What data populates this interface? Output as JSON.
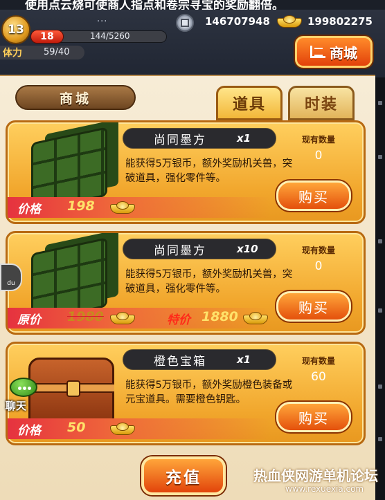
{
  "hud": {
    "ticker": "使用点云烧可使商人指点和卷宗寻宝的奖励翻倍。",
    "level_badge": "13",
    "player_name": "...",
    "level": "18",
    "exp": "144/5260",
    "exp_fraction": 0.027,
    "stamina_label": "体力",
    "stamina": "59/40",
    "silver": "146707948",
    "gold": "199802275",
    "shop_button": "商城",
    "icons": [
      "silver-coin-icon",
      "gold-ingot-icon",
      "cart-icon"
    ]
  },
  "panel": {
    "title": "商城",
    "tabs": [
      {
        "label": "道具",
        "active": true
      },
      {
        "label": "时装",
        "active": false
      }
    ]
  },
  "items": [
    {
      "name": "尚同墨方",
      "qty": "x1",
      "desc": "能获得5万银币，额外奖励机关兽，突破道具，强化零件等。",
      "stock_label": "现有数量",
      "stock": "0",
      "buy": "购买",
      "price_label": "价格",
      "price": "198"
    },
    {
      "name": "尚同墨方",
      "qty": "x10",
      "desc": "能获得5万银币，额外奖励机关兽，突破道具，强化零件等。",
      "stock_label": "现有数量",
      "stock": "0",
      "buy": "购买",
      "price_label": "原价",
      "price": "1980",
      "sale_label": "特价",
      "sale_price": "1880"
    },
    {
      "name": "橙色宝箱",
      "qty": "x1",
      "desc": "能获得5万银币，额外奖励橙色装备或元宝道具。需要橙色钥匙。",
      "stock_label": "现有数量",
      "stock": "60",
      "buy": "购买",
      "price_label": "价格",
      "price": "50"
    }
  ],
  "side": {
    "paw_label": "du",
    "chat_label": "聊天"
  },
  "footer": {
    "recharge": "充值",
    "watermark": "热血侠网游单机论坛",
    "watermark_sub": "www.rexuexia.com"
  }
}
